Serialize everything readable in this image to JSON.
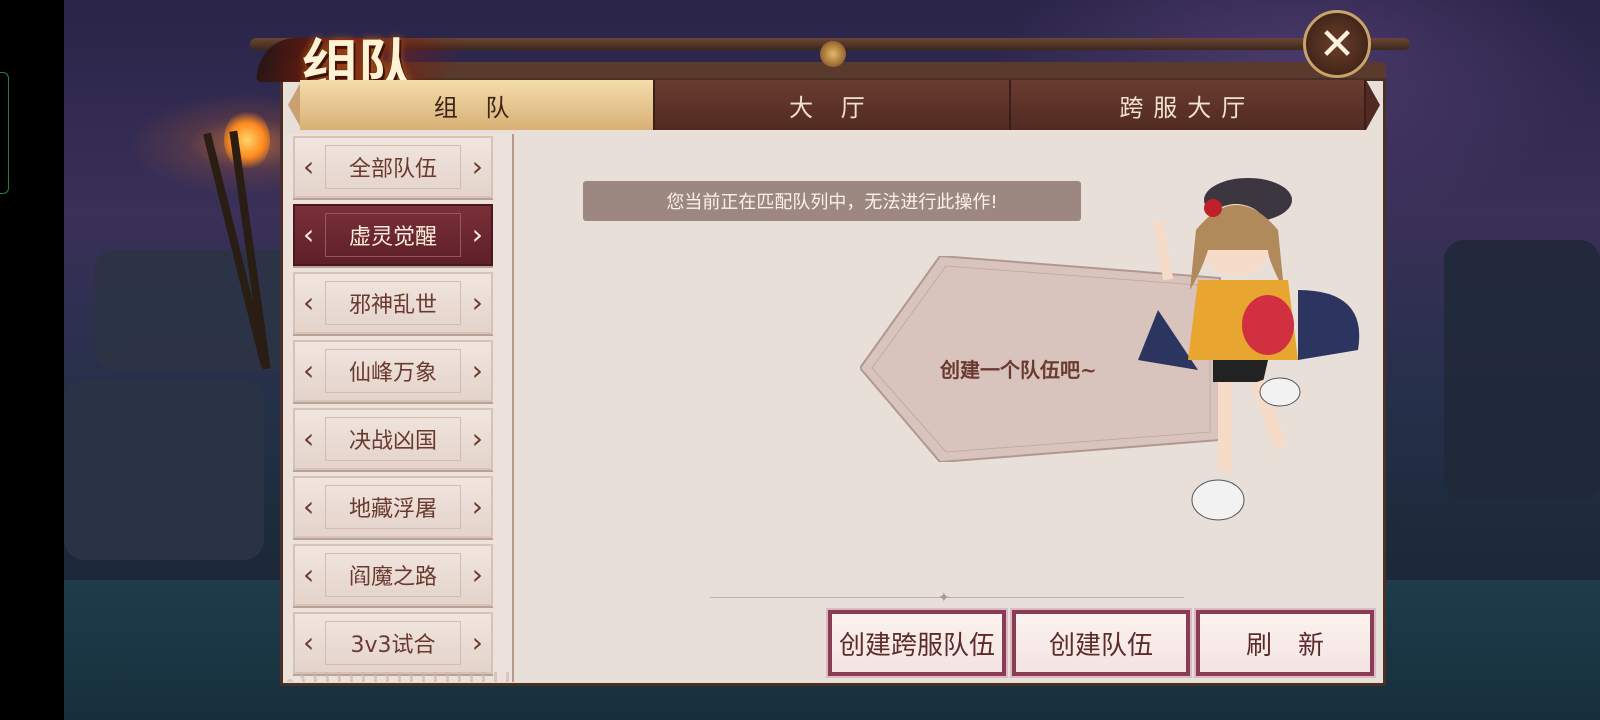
{
  "window": {
    "title": "组队"
  },
  "tabs": [
    {
      "label": "组 队",
      "active": true
    },
    {
      "label": "大 厅",
      "active": false
    },
    {
      "label": "跨服大厅",
      "active": false
    }
  ],
  "menu": {
    "items": [
      {
        "label": "全部队伍",
        "active": false
      },
      {
        "label": "虚灵觉醒",
        "active": true
      },
      {
        "label": "邪神乱世",
        "active": false
      },
      {
        "label": "仙峰万象",
        "active": false
      },
      {
        "label": "决战凶国",
        "active": false
      },
      {
        "label": "地藏浮屠",
        "active": false
      },
      {
        "label": "阎魔之路",
        "active": false
      },
      {
        "label": "3v3试合",
        "active": false
      }
    ]
  },
  "main": {
    "notice": "您当前正在匹配队列中，无法进行此操作!",
    "prompt": "创建一个队伍吧~"
  },
  "buttons": {
    "create_cross_server": "创建跨服队伍",
    "create_team": "创建队伍",
    "refresh": "刷　新"
  },
  "icons": {
    "close": "close-icon",
    "arrow_left": "chevron-left-icon",
    "arrow_right": "chevron-right-icon"
  },
  "colors": {
    "active_tab": "#d8b075",
    "active_menu": "#5e2029",
    "button_border": "#8b3c55"
  }
}
